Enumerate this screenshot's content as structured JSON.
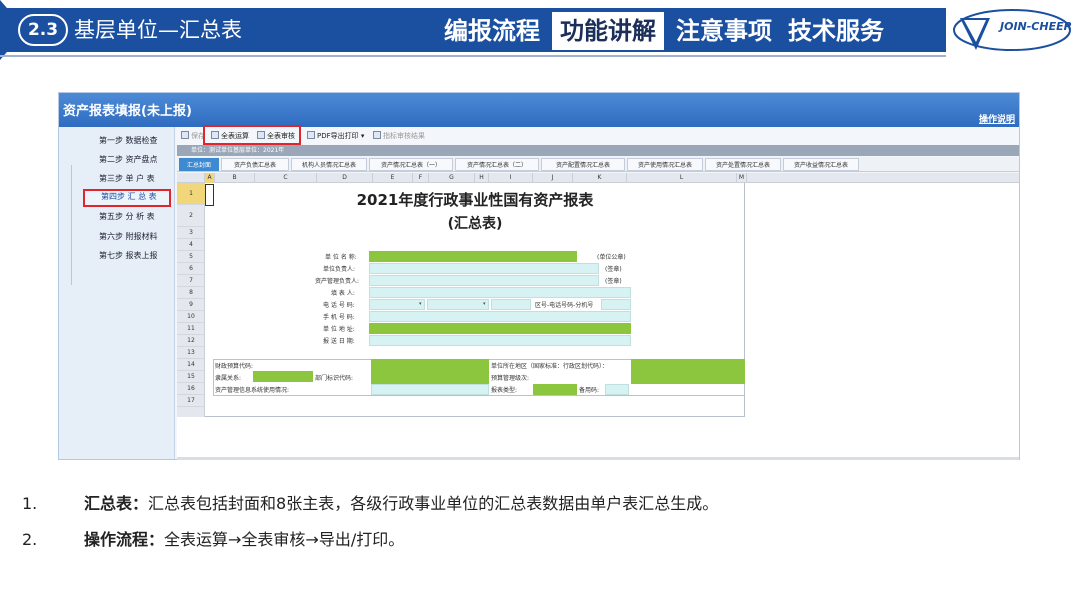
{
  "header": {
    "section_number": "2.3",
    "section_title": "基层单位—汇总表",
    "tabs": [
      {
        "label": "编报流程",
        "active": false
      },
      {
        "label": "功能讲解",
        "active": true
      },
      {
        "label": "注意事项",
        "active": false
      },
      {
        "label": "技术服务",
        "active": false
      }
    ],
    "logo_text": "JOIN-CHEER",
    "accent_color": "#1b4fa0"
  },
  "app": {
    "window_title": "资产报表填报(未上报)",
    "help_link": "操作说明",
    "sidebar": {
      "items": [
        {
          "label": "第一步 数据检查",
          "active": false
        },
        {
          "label": "第二步 资产盘点",
          "active": false
        },
        {
          "label": "第三步 单 户 表",
          "active": false
        },
        {
          "label": "第四步 汇 总 表",
          "active": true
        },
        {
          "label": "第五步 分 析 表",
          "active": false
        },
        {
          "label": "第六步 附报材料",
          "active": false
        },
        {
          "label": "第七步 报表上报",
          "active": false
        }
      ]
    },
    "toolbar": {
      "save": "保存",
      "calc_all": "全表运算",
      "audit_all": "全表审核",
      "pdf_export": "PDF导出打印",
      "more": "▾",
      "view_audit": "指标审核结果"
    },
    "unit_bar": "单位：测试单位基层单位：2021年",
    "tabs": [
      {
        "label": "汇总封面",
        "active": true
      },
      {
        "label": "资产负债汇总表",
        "active": false
      },
      {
        "label": "机构人员情况汇总表",
        "active": false
      },
      {
        "label": "资产情况汇总表（一）",
        "active": false
      },
      {
        "label": "资产情况汇总表（二）",
        "active": false
      },
      {
        "label": "资产配置情况汇总表",
        "active": false
      },
      {
        "label": "资产使用情况汇总表",
        "active": false
      },
      {
        "label": "资产处置情况汇总表",
        "active": false
      },
      {
        "label": "资产收益情况汇总表",
        "active": false
      }
    ],
    "columns": [
      "A",
      "B",
      "C",
      "D",
      "E",
      "F",
      "G",
      "H",
      "I",
      "J",
      "K",
      "L",
      "M"
    ],
    "rows": [
      "1",
      "2",
      "3",
      "4",
      "5",
      "6",
      "7",
      "8",
      "9",
      "10",
      "11",
      "12",
      "13",
      "14",
      "15",
      "16",
      "17"
    ],
    "sheet": {
      "title": "2021年度行政事业性国有资产报表",
      "subtitle": "(汇总表)",
      "fields": {
        "unit_name": "单 位 名 称:",
        "unit_name_note": "(单位公章)",
        "unit_head": "单位负责人:",
        "unit_head_note": "(签章)",
        "asset_manager": "资产管理负责人:",
        "asset_manager_note": "(签章)",
        "filler": "填  表  人:",
        "phone": "电  话  号  码:",
        "phone_note": "区号-电话号码-分机号",
        "mobile": "手  机  号  码:",
        "address": "单  位  地  址:",
        "report_date": "报  送  日  期:",
        "fiscal_code": "财政预算代码:",
        "region": "单位所在地区（国家标准：行政区划代码）：",
        "affiliation": "隶属关系:",
        "dept_code": "部门标识代码:",
        "budget_level": "预算管理级次:",
        "info_system": "资产管理信息系统使用情况:",
        "report_type": "报表类型:",
        "backup_code": "备用码:"
      },
      "colors": {
        "green": "#8cc63f",
        "cyan": "#d6f2f2"
      }
    }
  },
  "notes": [
    {
      "number": "1.",
      "title": "汇总表：",
      "text": "汇总表包括封面和8张主表，各级行政事业单位的汇总表数据由单户表汇总生成。"
    },
    {
      "number": "2.",
      "title": "操作流程：",
      "text": "全表运算→全表审核→导出/打印。"
    }
  ]
}
